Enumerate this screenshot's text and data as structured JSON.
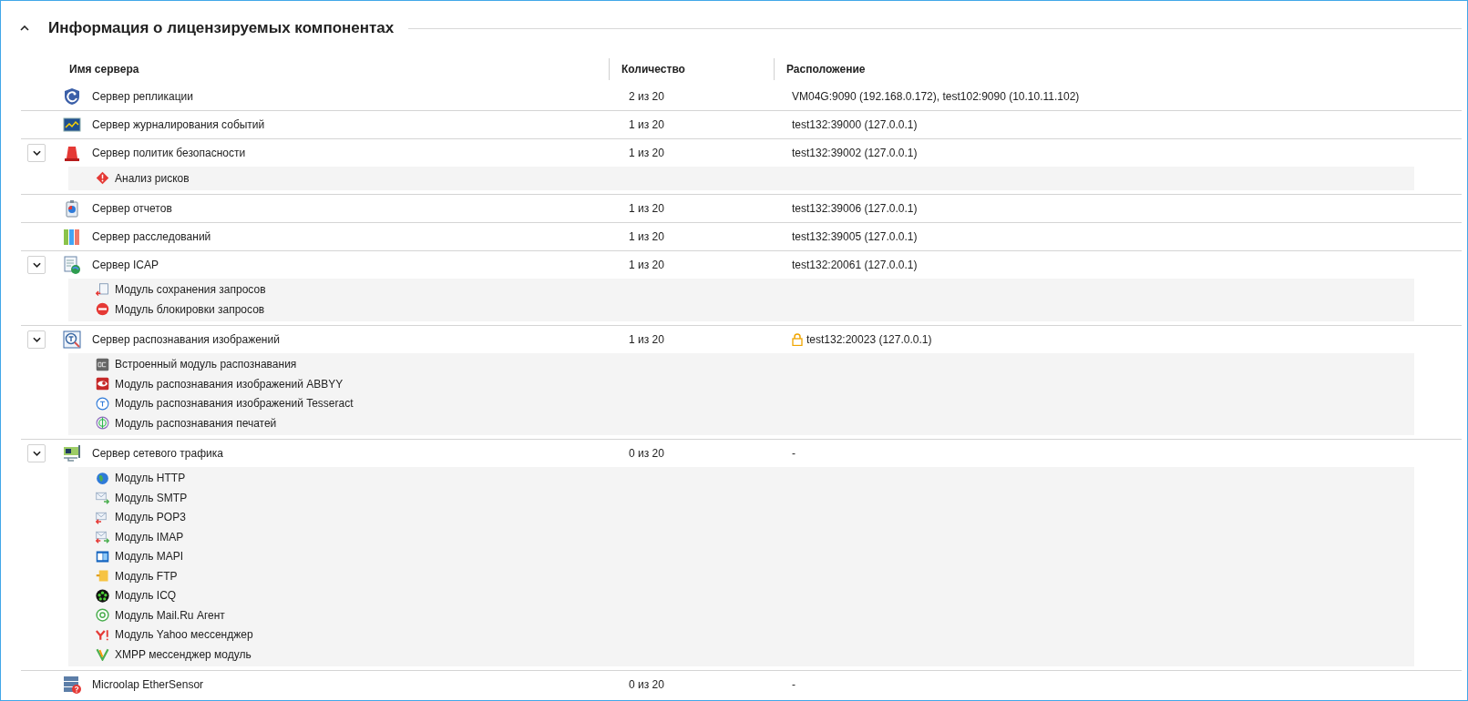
{
  "section": {
    "title": "Информация о лицензируемых компонентах",
    "expanded": true
  },
  "columns": [
    "Имя сервера",
    "Количество",
    "Расположение"
  ],
  "rows": [
    {
      "name": "Сервер репликации",
      "count": "2 из 20",
      "location": "VM04G:9090 (192.168.0.172), test102:9090 (10.10.11.102)",
      "locked": false
    },
    {
      "name": "Сервер журналирования событий",
      "count": "1 из 20",
      "location": "test132:39000 (127.0.0.1)",
      "locked": false
    },
    {
      "name": "Сервер политик безопасности",
      "count": "1 из 20",
      "location": "test132:39002 (127.0.0.1)",
      "locked": false,
      "expanded": true,
      "children": [
        "Анализ рисков"
      ]
    },
    {
      "name": "Сервер отчетов",
      "count": "1 из 20",
      "location": "test132:39006 (127.0.0.1)",
      "locked": false
    },
    {
      "name": "Сервер расследований",
      "count": "1 из 20",
      "location": "test132:39005 (127.0.0.1)",
      "locked": false
    },
    {
      "name": "Сервер ICAP",
      "count": "1 из 20",
      "location": "test132:20061 (127.0.0.1)",
      "locked": false,
      "expanded": true,
      "children": [
        "Модуль сохранения запросов",
        "Модуль блокировки запросов"
      ]
    },
    {
      "name": "Сервер распознавания изображений",
      "count": "1 из 20",
      "location": "test132:20023 (127.0.0.1)",
      "locked": true,
      "expanded": true,
      "children": [
        "Встроенный модуль распознавания",
        "Модуль распознавания изображений ABBYY",
        "Модуль распознавания изображений Tesseract",
        "Модуль распознавания печатей"
      ]
    },
    {
      "name": "Сервер сетевого трафика",
      "count": "0 из 20",
      "location": "-",
      "locked": false,
      "expanded": true,
      "children": [
        "Модуль HTTP",
        "Модуль SMTP",
        "Модуль POP3",
        "Модуль IMAP",
        "Модуль MAPI",
        "Модуль FTP",
        "Модуль ICQ",
        "Модуль Mail.Ru Агент",
        "Модуль Yahoo мессенджер",
        "XMPP мессенджер модуль"
      ]
    },
    {
      "name": "Microolap EtherSensor",
      "count": "0 из 20",
      "location": "-",
      "locked": false
    }
  ]
}
